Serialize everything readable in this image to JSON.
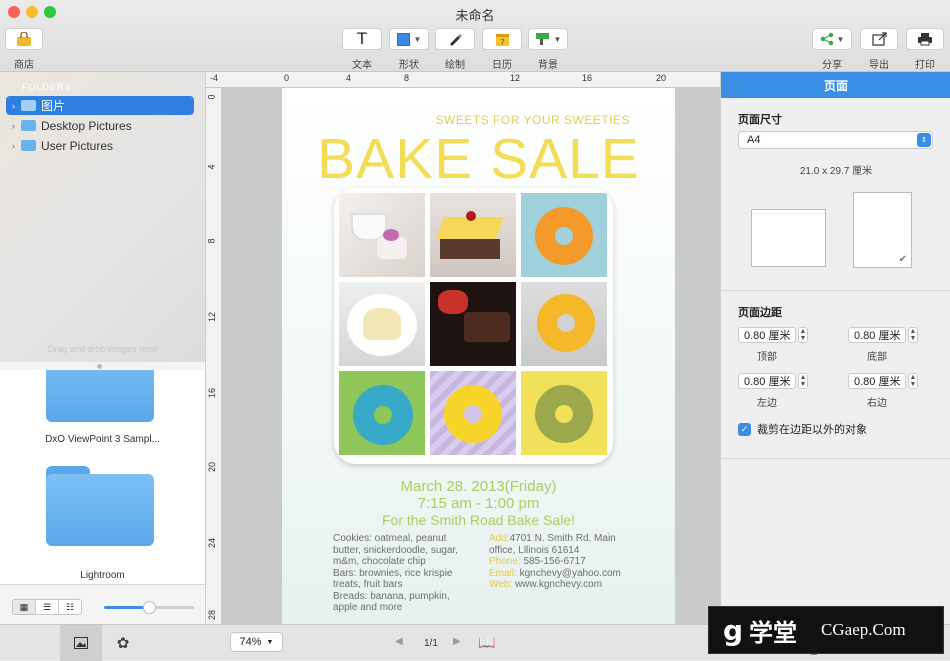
{
  "window": {
    "title": "未命名"
  },
  "toolbar": {
    "store_label": "商店",
    "text_label": "文本",
    "text_glyph": "T",
    "shape_label": "形状",
    "draw_label": "绘制",
    "calendar_label": "日历",
    "background_label": "背景",
    "share_label": "分享",
    "export_label": "导出",
    "print_label": "打印"
  },
  "sidebar": {
    "section_header": "FOLDERS",
    "items": [
      {
        "label": "图片",
        "selected": true
      },
      {
        "label": "Desktop Pictures",
        "selected": false
      },
      {
        "label": "User Pictures",
        "selected": false
      }
    ],
    "drop_hint": "Drag and drop images here",
    "grid": [
      {
        "label": "DxO ViewPoint 3 Sampl..."
      },
      {
        "label": "Lightroom"
      }
    ]
  },
  "rulers": {
    "horizontal": [
      "-4",
      "0",
      "4",
      "8",
      "12",
      "16",
      "20"
    ],
    "vertical": [
      "0",
      "4",
      "8",
      "12",
      "16",
      "20",
      "24",
      "28"
    ]
  },
  "flyer": {
    "tagline": "SWEETS FOR YOUR SWEETIES",
    "headline": "BAKE SALE",
    "date_line": "March 28. 2013(Friday)",
    "time_line": "7:15 am - 1:00 pm",
    "event_line": "For the Smith Road Bake Sale!",
    "menu": [
      "Cookies: oatmeal, peanut",
      "butter, snickerdoodle, sugar,",
      "m&m, chocolate chip",
      "Bars: brownies, rice krispie",
      "treats, fruit bars",
      "Breads:  banana, pumpkin,",
      "apple and more"
    ],
    "contact": {
      "add_label": "Add:",
      "add_value": "4701 N. Smith Rd. Main",
      "add_value2": "office,  Lllinois 61614",
      "phone_label": "Phone:",
      "phone_value": "585-156-6717",
      "email_label": "Email:",
      "email_value": "kgnchevy@yahoo.com",
      "web_label": "Web:",
      "web_value": "www.kgnchevy.com"
    }
  },
  "inspector": {
    "header": "页面",
    "page_size_label": "页面尺寸",
    "page_size_value": "A4",
    "dimensions": "21.0 x 29.7 厘米",
    "margins_label": "页面边距",
    "top_value": "0.80 厘米",
    "top_label": "顶部",
    "bottom_value": "0.80 厘米",
    "bottom_label": "底部",
    "left_value": "0.80 厘米",
    "left_label": "左边",
    "right_value": "0.80 厘米",
    "right_label": "右边",
    "clip_label": "裁剪在边距以外的对象",
    "clip_checked": true
  },
  "bottombar": {
    "zoom": "74%",
    "page_indicator": "1/1"
  },
  "watermark": {
    "brand_cn": "学堂",
    "brand_url": "CGaep.Com"
  },
  "colors": {
    "accent": "#3b8ee6",
    "flyer_yellow": "#f2dd55",
    "flyer_green": "#a8cf5a",
    "menu_gray": "#6e6e6e",
    "contact_yellow": "#e6c84e"
  }
}
